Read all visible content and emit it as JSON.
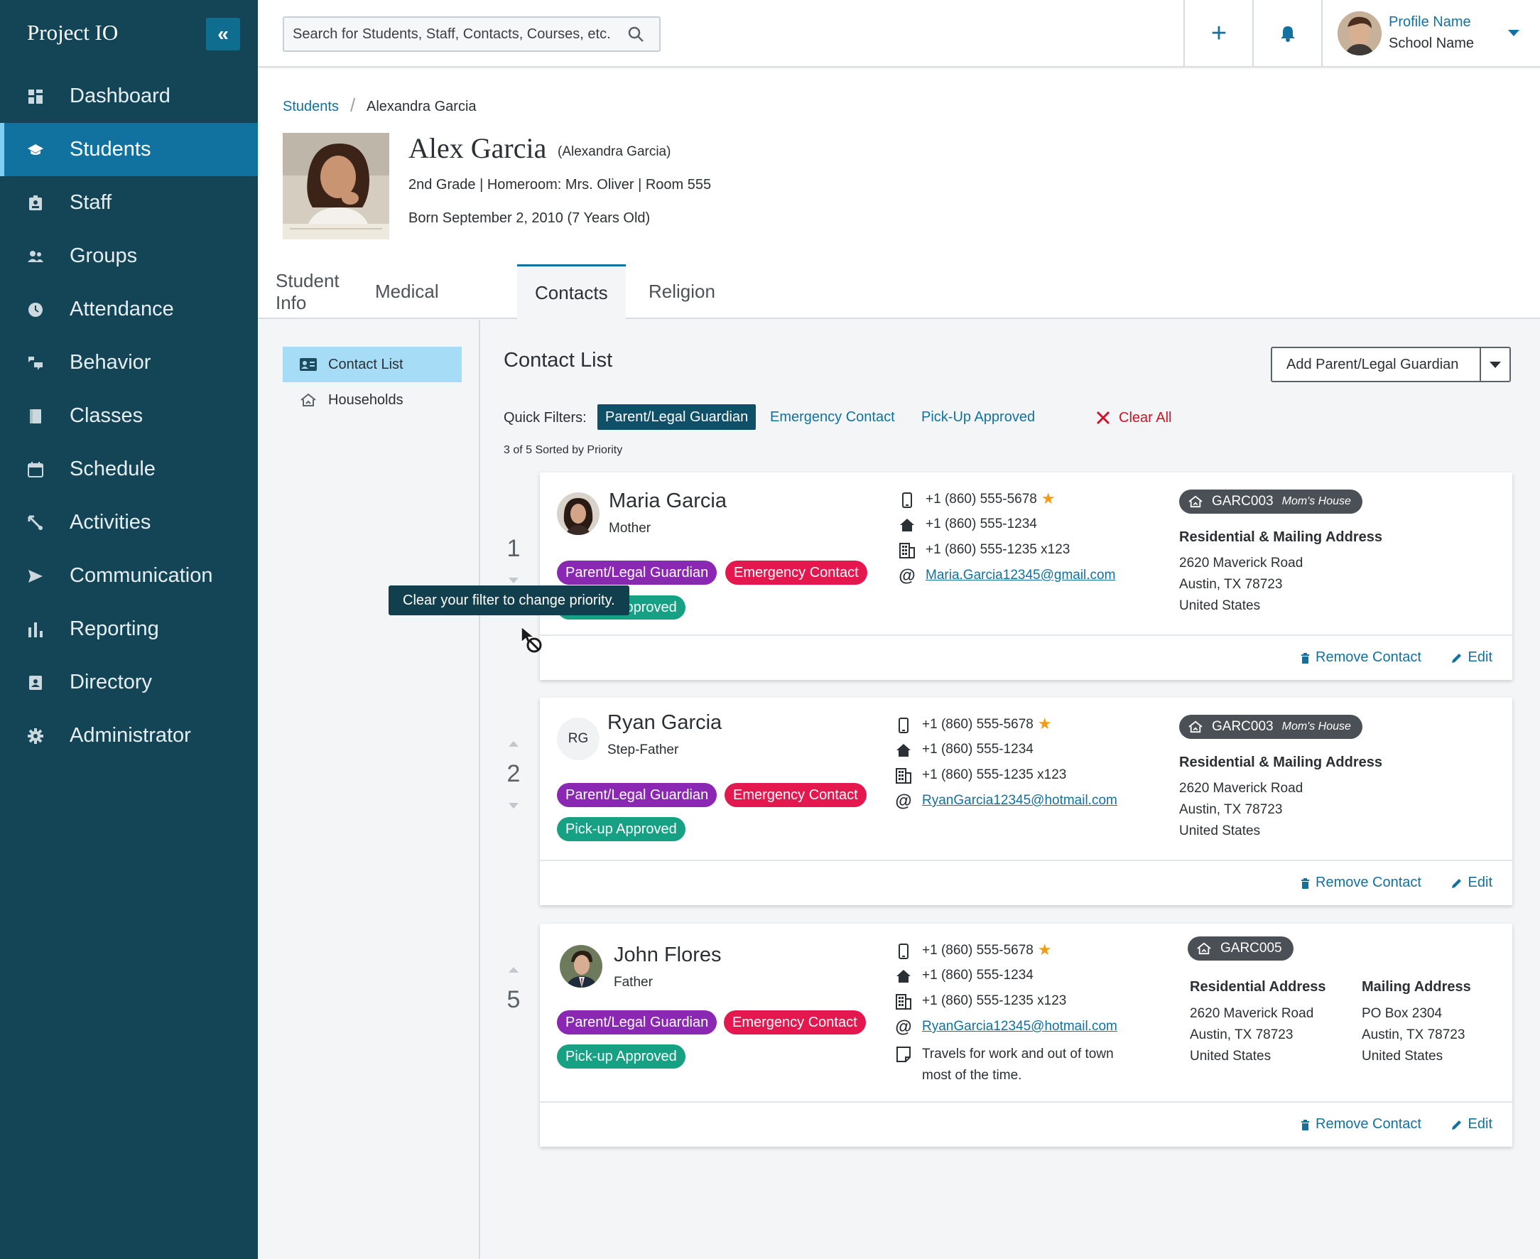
{
  "app": {
    "title": "Project IO"
  },
  "sidebar": {
    "collapse_glyph": "«",
    "items": [
      {
        "label": "Dashboard",
        "icon": "dashboard-icon"
      },
      {
        "label": "Students",
        "icon": "graduation-cap-icon",
        "active": true
      },
      {
        "label": "Staff",
        "icon": "id-badge-icon"
      },
      {
        "label": "Groups",
        "icon": "people-icon"
      },
      {
        "label": "Attendance",
        "icon": "clock-icon"
      },
      {
        "label": "Behavior",
        "icon": "behavior-icon"
      },
      {
        "label": "Classes",
        "icon": "book-icon"
      },
      {
        "label": "Schedule",
        "icon": "calendar-icon"
      },
      {
        "label": "Activities",
        "icon": "activities-icon"
      },
      {
        "label": "Communication",
        "icon": "send-icon"
      },
      {
        "label": "Reporting",
        "icon": "bar-chart-icon"
      },
      {
        "label": "Directory",
        "icon": "contact-card-icon"
      },
      {
        "label": "Administrator",
        "icon": "gear-icon"
      }
    ]
  },
  "topbar": {
    "search_placeholder": "Search for Students, Staff, Contacts, Courses, etc.",
    "plus_glyph": "+",
    "profile_name": "Profile Name",
    "school_name": "School Name"
  },
  "breadcrumb": {
    "root": "Students",
    "separator": "/",
    "current": "Alexandra Garcia"
  },
  "student": {
    "name": "Alex Garcia",
    "legal_name": "(Alexandra Garcia)",
    "meta": "2nd Grade | Homeroom: Mrs. Oliver | Room 555",
    "born": "Born September 2, 2010 (7 Years Old)"
  },
  "tabs": [
    {
      "label": "Student Info"
    },
    {
      "label": "Medical"
    },
    {
      "label": "Contacts",
      "active": true
    },
    {
      "label": "Religion"
    }
  ],
  "subnav": {
    "contact_list": "Contact List",
    "households": "Households"
  },
  "content": {
    "title": "Contact List",
    "add_button": "Add Parent/Legal Guardian",
    "quick_filters_label": "Quick Filters:",
    "filters": [
      "Parent/Legal Guardian",
      "Emergency Contact",
      "Pick-Up Approved"
    ],
    "clear_all": "Clear All",
    "sort_note": "3 of 5 Sorted by Priority",
    "tooltip": "Clear your filter to change priority."
  },
  "contacts": [
    {
      "priority": "1",
      "name": "Maria Garcia",
      "relation": "Mother",
      "tags": [
        "Parent/Legal Guardian",
        "Emergency Contact",
        "Pick-up Approved"
      ],
      "mobile": "+1 (860) 555-5678",
      "home": "+1 (860) 555-1234",
      "work": "+1 (860) 555-1235 x123",
      "email": "Maria.Garcia12345@gmail.com",
      "household": "GARC003",
      "household_name": "Mom's House",
      "address_heading": "Residential & Mailing Address",
      "address": [
        "2620 Maverick Road",
        "Austin, TX  78723",
        "United States"
      ],
      "remove": "Remove Contact",
      "edit": "Edit"
    },
    {
      "priority": "2",
      "name": "Ryan Garcia",
      "initials": "RG",
      "relation": "Step-Father",
      "tags": [
        "Parent/Legal Guardian",
        "Emergency Contact",
        "Pick-up Approved"
      ],
      "mobile": "+1 (860) 555-5678",
      "home": "+1 (860) 555-1234",
      "work": "+1 (860) 555-1235 x123",
      "email": "RyanGarcia12345@hotmail.com",
      "household": "GARC003",
      "household_name": "Mom's House",
      "address_heading": "Residential & Mailing Address",
      "address": [
        "2620 Maverick Road",
        "Austin, TX  78723",
        "United States"
      ],
      "remove": "Remove Contact",
      "edit": "Edit"
    },
    {
      "priority": "5",
      "name": "John Flores",
      "relation": "Father",
      "tags": [
        "Parent/Legal Guardian",
        "Emergency Contact",
        "Pick-up Approved"
      ],
      "mobile": "+1 (860) 555-5678",
      "home": "+1 (860) 555-1234",
      "work": "+1 (860) 555-1235 x123",
      "email": "RyanGarcia12345@hotmail.com",
      "note": "Travels for work and out of town most of the time.",
      "household": "GARC005",
      "res_heading": "Residential Address",
      "res_address": [
        "2620 Maverick Road",
        "Austin, TX  78723",
        "United States"
      ],
      "mail_heading": "Mailing Address",
      "mail_address": [
        "PO Box 2304",
        "Austin, TX  78723",
        "United States"
      ],
      "remove": "Remove Contact",
      "edit": "Edit"
    }
  ],
  "colors": {
    "sidebar": "#144556",
    "accent": "#1172a0",
    "tag_purple": "#8a27b3",
    "tag_red": "#e4184f",
    "tag_green": "#16a184",
    "star": "#f39c12"
  }
}
